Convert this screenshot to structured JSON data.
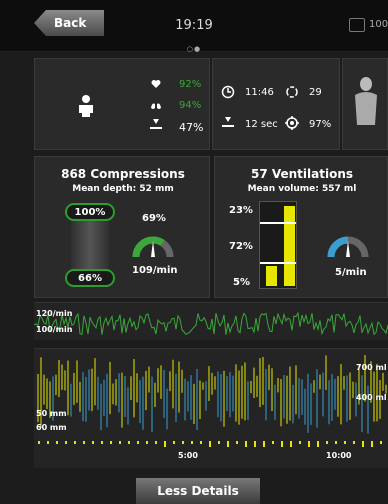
{
  "header": {
    "back_label": "Back",
    "time": "19:19",
    "battery_label": "100"
  },
  "summary": {
    "heart_pct": "92%",
    "lungs_pct": "94%",
    "hand_pct": "47%",
    "clock_time": "11:46",
    "cycle_count": "29",
    "pause_time": "12 sec",
    "target_pct": "97%"
  },
  "compressions": {
    "title": "868 Compressions",
    "subtitle": "Mean depth: 52 mm",
    "top_pill": "100%",
    "bottom_pill": "66%",
    "gauge_pct": "69%",
    "gauge_rate": "109/min",
    "gauge_fraction": 0.69
  },
  "ventilations": {
    "title": "57 Ventilations",
    "subtitle": "Mean volume: 557 ml",
    "bar_labels": [
      "23%",
      "72%",
      "5%"
    ],
    "gauge_rate": "5/min",
    "gauge_fraction": 0.5
  },
  "rate_chart": {
    "labels": [
      "120/min",
      "100/min"
    ]
  },
  "depth_chart": {
    "left_labels": [
      "50 mm",
      "60 mm"
    ],
    "right_labels": [
      "700 ml",
      "400 ml"
    ],
    "x_ticks": [
      "5:00",
      "10:00"
    ]
  },
  "footer": {
    "less_details_label": "Less Details"
  },
  "colors": {
    "green": "#3aa83a",
    "yellow": "#e6e600",
    "blue": "#3a9fd0",
    "panel": "#2a2a2a"
  }
}
